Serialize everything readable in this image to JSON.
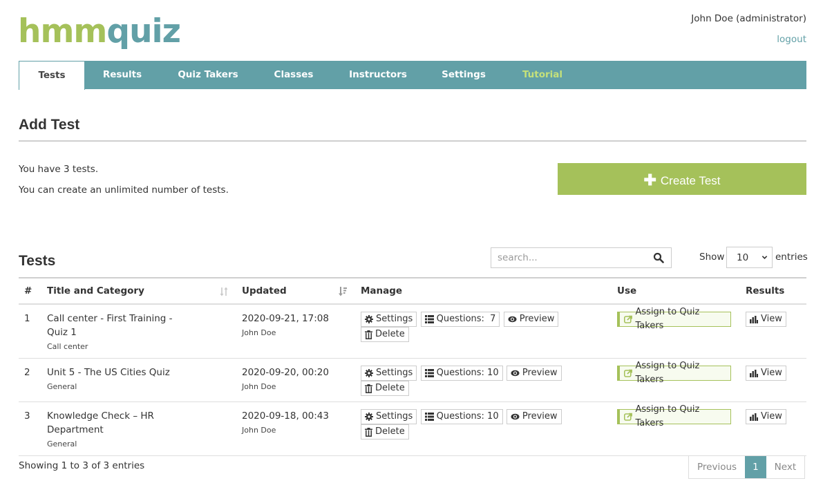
{
  "brand": {
    "logo_part1": "hmm",
    "logo_part2": "quiz"
  },
  "user": {
    "name": "John Doe (administrator)",
    "logout": "logout"
  },
  "nav": {
    "tabs": [
      {
        "label": "Tests",
        "active": true
      },
      {
        "label": "Results"
      },
      {
        "label": "Quiz Takers"
      },
      {
        "label": "Classes"
      },
      {
        "label": "Instructors"
      },
      {
        "label": "Settings"
      },
      {
        "label": "Tutorial"
      }
    ]
  },
  "add_test": {
    "heading": "Add Test",
    "count_text": "You have 3 tests.",
    "limit_text": "You can create an unlimited number of tests.",
    "create_button": "Create Test"
  },
  "tests": {
    "heading": "Tests",
    "search_placeholder": "search...",
    "show_label": "Show",
    "entries_value": "10",
    "entries_label": "entries",
    "columns": [
      "#",
      "Title and Category",
      "Updated",
      "Manage",
      "Use",
      "Results"
    ],
    "rows": [
      {
        "num": "1",
        "title": "Call center - First Training - Quiz 1",
        "category": "Call center",
        "updated": "2020-09-21, 17:08",
        "updated_by": "John Doe",
        "questions": "Questions:  7"
      },
      {
        "num": "2",
        "title": "Unit 5 - The US Cities Quiz",
        "category": "General",
        "updated": "2020-09-20, 00:20",
        "updated_by": "John Doe",
        "questions": "Questions: 10"
      },
      {
        "num": "3",
        "title": "Knowledge Check – HR Department",
        "category": "General",
        "updated": "2020-09-18, 00:43",
        "updated_by": "John Doe",
        "questions": "Questions: 10"
      }
    ],
    "buttons": {
      "settings": "Settings",
      "preview": "Preview",
      "delete": "Delete",
      "assign": "Assign to Quiz Takers",
      "view": "View"
    },
    "showing_text": "Showing 1 to 3 of 3 entries",
    "pagination": {
      "previous": "Previous",
      "current": "1",
      "next": "Next"
    }
  },
  "colors": {
    "teal": "#62a0a7",
    "green": "#a5c15a",
    "tutorial": "#c5e17a"
  }
}
